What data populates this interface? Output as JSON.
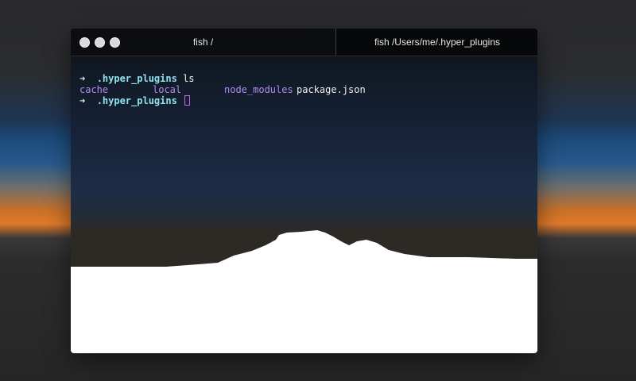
{
  "window": {
    "tabs": [
      {
        "label": "fish /"
      },
      {
        "label": "fish /Users/me/.hyper_plugins"
      }
    ]
  },
  "terminal": {
    "line1": {
      "prompt": "➜",
      "dir": ".hyper_plugins",
      "command": "ls"
    },
    "listing": [
      {
        "name": "cache",
        "kind": "directory"
      },
      {
        "name": "local",
        "kind": "directory"
      },
      {
        "name": "node_modules",
        "kind": "directory"
      },
      {
        "name": "package.json",
        "kind": "file"
      }
    ],
    "line3": {
      "prompt": "➜",
      "dir": ".hyper_plugins"
    }
  },
  "colors": {
    "prompt_dir": "#8fe3ef",
    "directory": "#b18bf0",
    "cursor": "#c06bd8"
  }
}
